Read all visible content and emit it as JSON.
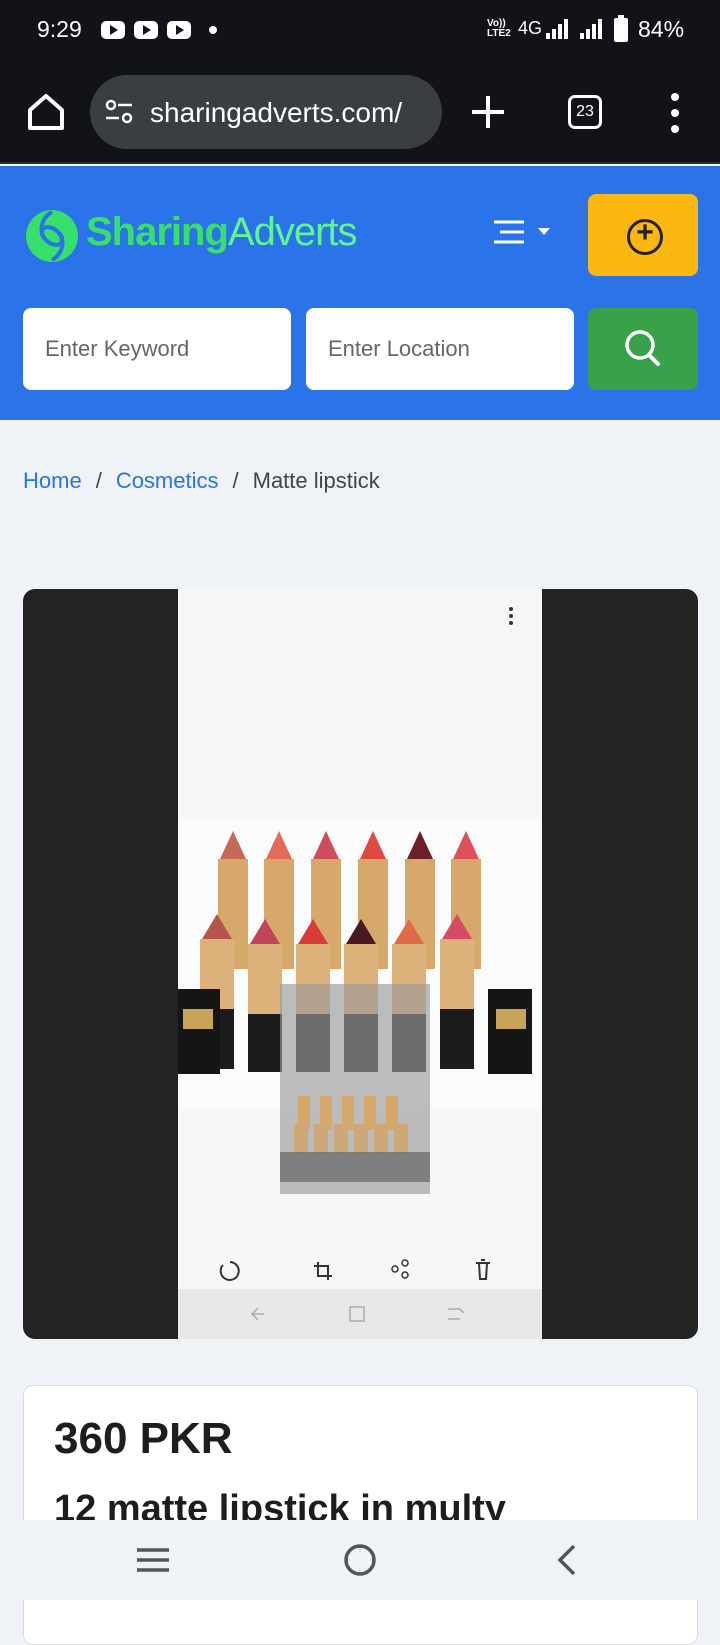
{
  "status_bar": {
    "time": "9:29",
    "notification_icons": [
      "youtube-icon",
      "youtube-icon",
      "youtube-icon"
    ],
    "volte_label": "Vo)) LTE2",
    "network": "4G",
    "battery": "84%"
  },
  "browser": {
    "url": "sharingadverts.com/",
    "tab_count": "23"
  },
  "header": {
    "logo_part1": "Sharing",
    "logo_part2": "Adverts",
    "keyword_placeholder": "Enter Keyword",
    "location_placeholder": "Enter Location",
    "colors": {
      "header_bg": "#2a73e8",
      "post_button": "#fcb811",
      "search_button": "#38a14a",
      "logo": "#37e06a"
    }
  },
  "breadcrumb": {
    "home": "Home",
    "category": "Cosmetics",
    "current": "Matte lipstick",
    "separator": "/"
  },
  "listing": {
    "price": "360 PKR",
    "title": "12 matte lipstick in multy"
  }
}
